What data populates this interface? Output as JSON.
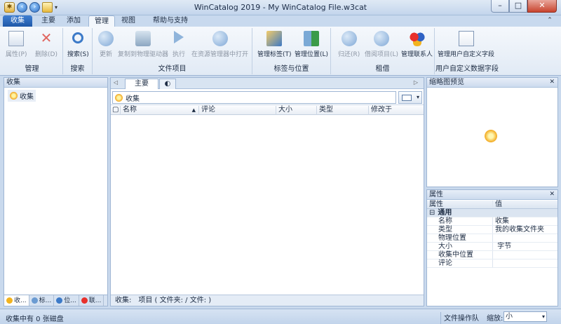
{
  "window": {
    "title": "WinCatalog 2019 - My WinCatalog File.w3cat"
  },
  "ribbon_tabs": [
    "收集",
    "主要",
    "添加",
    "管理",
    "视图",
    "帮助与支持"
  ],
  "ribbon": {
    "manage": {
      "label": "管理",
      "properties": "属性(P)",
      "delete": "删除(D)"
    },
    "search": {
      "label": "搜索",
      "search": "搜索(S)"
    },
    "file_items": {
      "label": "文件项目",
      "update": "更新",
      "copy_to_drive": "复制到物理驱动器",
      "execute": "执行",
      "open_in_explorer": "在资源管理器中打开"
    },
    "tags_locations": {
      "label": "标签与位置",
      "manage_tags": "管理标签(T)",
      "manage_locations": "管理位置(L)"
    },
    "rental": {
      "label": "租借",
      "return": "归还(R)",
      "borrowed_items": "借阅项目(L)",
      "manage_contacts": "管理联系人"
    },
    "custom_fields": {
      "label": "用户自定义数据字段",
      "manage": "管理用户自定义字段"
    }
  },
  "left_panel": {
    "title": "收集",
    "tree_root": "收集",
    "bottom_tabs": [
      "收...",
      "标...",
      "位...",
      "联..."
    ]
  },
  "center": {
    "tabs": {
      "main": "主要"
    },
    "address": "收集",
    "columns": [
      "名称",
      "评论",
      "大小",
      "类型",
      "修改于"
    ],
    "status_label": "收集:",
    "status_items": "项目 ( 文件夹: / 文件: )"
  },
  "thumbnail_panel": {
    "title": "缩略图预览"
  },
  "properties_panel": {
    "title": "属性",
    "col_property": "属性",
    "col_value": "值",
    "category": "通用",
    "rows": [
      {
        "k": "名称",
        "v": "收集"
      },
      {
        "k": "类型",
        "v": "我的收集文件夹"
      },
      {
        "k": "物理位置",
        "v": ""
      },
      {
        "k": "大小",
        "v": " 字节"
      },
      {
        "k": "收集中位置",
        "v": ""
      },
      {
        "k": "评论",
        "v": ""
      }
    ]
  },
  "status_bar": {
    "left": "收集中有 0 张磁盘",
    "queue": "文件操作队列",
    "zoom_label": "缩放:",
    "zoom_value": "小"
  }
}
